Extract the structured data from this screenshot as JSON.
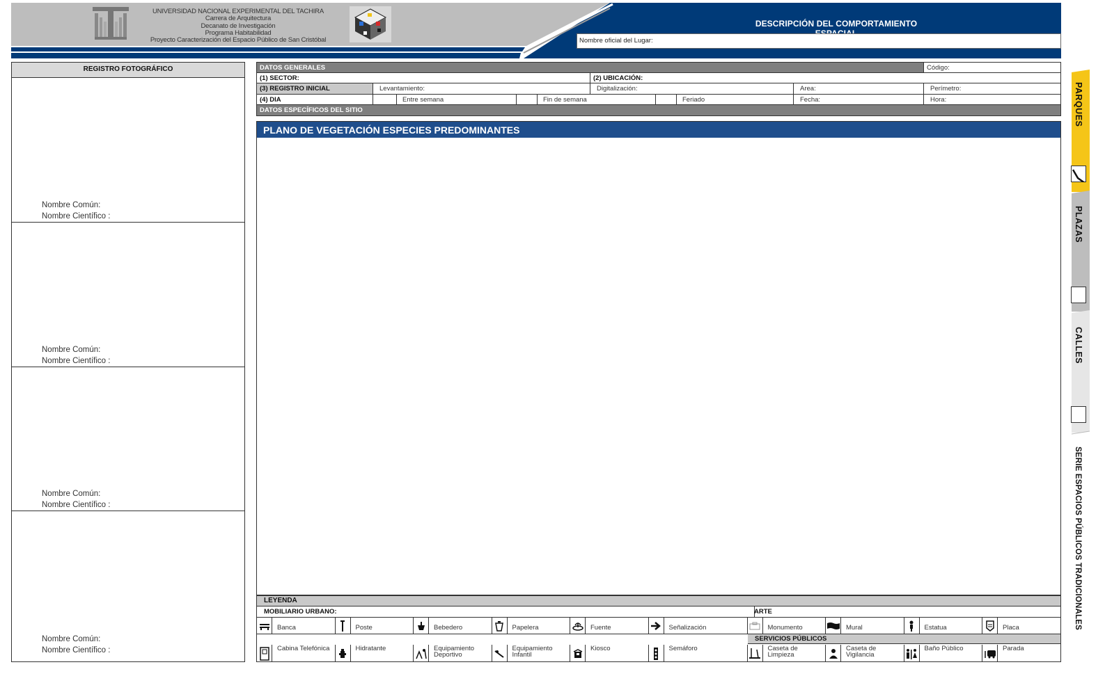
{
  "header": {
    "university_lines": [
      "UNIVERSIDAD NACIONAL EXPERIMENTAL DEL TACHIRA",
      "Carrera de Arquitectura",
      "Decanato de Investigación",
      "Programa Habitabilidad",
      "Proyecto Caracterización del Espacio Público de San Cristóbal"
    ],
    "title": "DESCRIPCIÓN  DEL COMPORTAMIENTO ESPACIAL",
    "nombre_label": "Nombre oficial del Lugar:",
    "colors": {
      "navy": "#003a78",
      "gray": "#bdbdbd"
    }
  },
  "photos": {
    "title": "REGISTRO FOTOGRÁFICO",
    "cells": [
      {
        "common": "Nombre Común:",
        "scientific": "Nombre Científico :"
      },
      {
        "common": "Nombre Común:",
        "scientific": "Nombre Científico :"
      },
      {
        "common": "Nombre Común:",
        "scientific": "Nombre Científico :"
      },
      {
        "common": "Nombre Común:",
        "scientific": "Nombre Científico :"
      }
    ]
  },
  "datos": {
    "generales": "DATOS GENERALES",
    "codigo": "Código:",
    "sector": "(1) SECTOR:",
    "ubicacion": "(2) UBICACIÓN:",
    "registro": "(3) REGISTRO INICIAL",
    "levantamiento": "Levantamiento:",
    "digitalizacion": "Digitalización:",
    "area": "Area:",
    "perimetro": "Perímetro:",
    "dia": "(4) DIA",
    "entre_semana": "Entre semana",
    "fin_semana": "Fin de semana",
    "feriado": "Feriado",
    "fecha": "Fecha:",
    "hora": "Hora:",
    "especificos": "DATOS ESPECÍFICOS DEL SITIO"
  },
  "plano": {
    "title": "PLANO DE VEGETACIÓN ESPECIES PREDOMINANTES"
  },
  "leyenda": {
    "title": "LEYENDA",
    "mobiliario": "MOBILIARIO URBANO:",
    "arte": "ARTE",
    "servicios": "SERVICIOS PÚBLICOS",
    "row1": [
      {
        "label": "Banca",
        "icon": "bench-icon"
      },
      {
        "label": "Poste",
        "icon": "post-icon"
      },
      {
        "label": "Bebedero",
        "icon": "fountain-drink-icon"
      },
      {
        "label": "Papelera",
        "icon": "trash-bin-icon"
      },
      {
        "label": "Fuente",
        "icon": "water-fountain-icon"
      },
      {
        "label": "Señalización",
        "icon": "arrow-right-icon"
      },
      {
        "label": "Monumento",
        "icon": "monument-icon"
      },
      {
        "label": "Mural",
        "icon": "mural-icon"
      },
      {
        "label": "Estatua",
        "icon": "statue-icon"
      },
      {
        "label": "Placa",
        "icon": "plaque-icon"
      }
    ],
    "row2": [
      {
        "label": "Cabina Telefónica",
        "icon": "phone-booth-icon"
      },
      {
        "label": "Hidratante",
        "icon": "hydrant-icon"
      },
      {
        "label": "Equipamiento Deportivo",
        "icon": "sports-icon"
      },
      {
        "label": "Equipamiento Infantil",
        "icon": "playground-icon"
      },
      {
        "label": "Kiosco",
        "icon": "kiosk-icon"
      },
      {
        "label": "Semáforo",
        "icon": "traffic-light-icon"
      },
      {
        "label": "Caseta de Limpieza",
        "icon": "cleaning-icon"
      },
      {
        "label": "Caseta de Vigilancia",
        "icon": "guard-icon"
      },
      {
        "label": "Baño Público",
        "icon": "restroom-icon"
      },
      {
        "label": "Parada",
        "icon": "bus-stop-icon"
      }
    ]
  },
  "tabs": {
    "parques": "PARQUES",
    "plazas": "PLAZAS",
    "calles": "CALLES",
    "serie": "SERIE ESPACIOS PÚBLICOS TRADICIONALES",
    "parques_color": "#f5c518"
  }
}
